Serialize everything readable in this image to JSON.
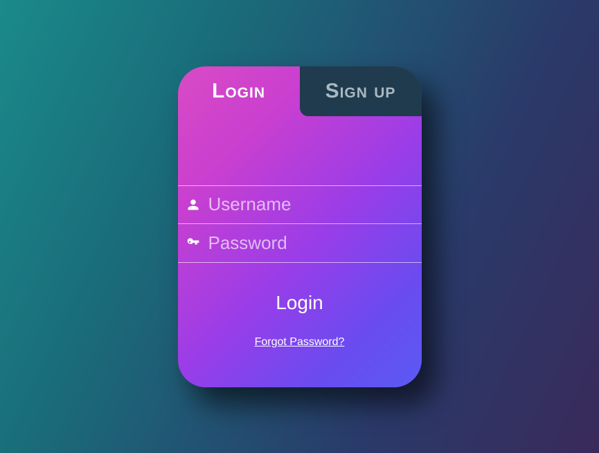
{
  "tabs": {
    "login": "Login",
    "signup": "Sign up"
  },
  "fields": {
    "username_placeholder": "Username",
    "password_placeholder": "Password"
  },
  "actions": {
    "submit_label": "Login",
    "forgot_label": "Forgot Password?"
  }
}
